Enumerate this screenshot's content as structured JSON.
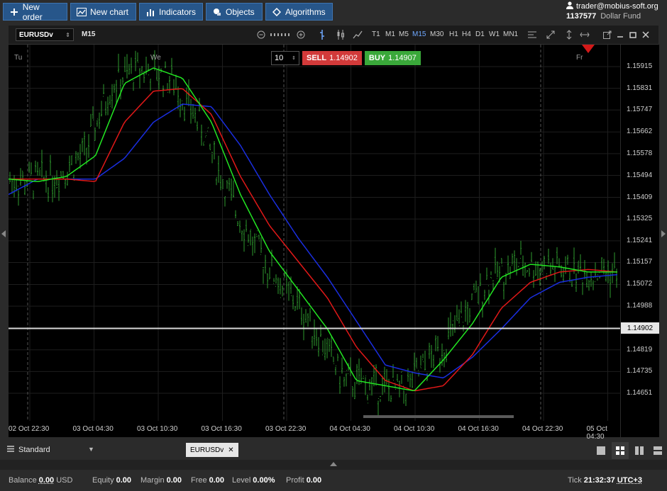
{
  "toolbar": {
    "buttons": [
      {
        "label": "New order",
        "icon": "plus-icon"
      },
      {
        "label": "New chart",
        "icon": "chart-icon"
      },
      {
        "label": "Indicators",
        "icon": "bar-chart-icon"
      },
      {
        "label": "Objects",
        "icon": "objects-icon"
      },
      {
        "label": "Algorithms",
        "icon": "diamond-icon"
      }
    ]
  },
  "account": {
    "user": "trader@mobius-soft.org",
    "number": "1137577",
    "fund": "Dollar Fund"
  },
  "chart": {
    "symbol": "EURUSDv",
    "timeframe": "M15",
    "timeframes": [
      "T1",
      "M1",
      "M5",
      "M15",
      "M30",
      "H1",
      "H4",
      "D1",
      "W1",
      "MN1"
    ],
    "active_timeframe": "M15",
    "days": [
      "Tu",
      "We",
      "Fr"
    ],
    "trade": {
      "lots": "10",
      "sell_label": "SELL",
      "sell_price": "1.14902",
      "buy_label": "BUY",
      "buy_price": "1.14907"
    },
    "price_labels": [
      "1.15915",
      "1.15831",
      "1.15747",
      "1.15662",
      "1.15578",
      "1.15494",
      "1.15409",
      "1.15325",
      "1.15241",
      "1.15157",
      "1.15072",
      "1.14988",
      "1.14902",
      "1.14819",
      "1.14735",
      "1.14651"
    ],
    "current_price": "1.14902",
    "time_labels": [
      "02 Oct 22:30",
      "03 Oct 04:30",
      "03 Oct 10:30",
      "03 Oct 16:30",
      "03 Oct 22:30",
      "04 Oct 04:30",
      "04 Oct 10:30",
      "04 Oct 16:30",
      "04 Oct 22:30",
      "05 Oct 04:30"
    ],
    "colors": {
      "bars": "#2e9a2e",
      "ma_fast": "#22e622",
      "ma_mid": "#e01818",
      "ma_slow": "#1a2ee0",
      "price_line": "#d9d9d9"
    }
  },
  "chart_data": {
    "type": "line",
    "series": [
      {
        "values": [
          1.1548,
          1.1547,
          1.1549,
          1.1557,
          1.1585,
          1.1591,
          1.1587,
          1.157,
          1.1542,
          1.152,
          1.1505,
          1.149,
          1.147,
          1.1468,
          1.1466,
          1.1478,
          1.1492,
          1.151,
          1.1515,
          1.1514,
          1.1512,
          1.1512
        ]
      },
      {
        "values": [
          1.1548,
          1.1548,
          1.1548,
          1.1547,
          1.157,
          1.1582,
          1.1583,
          1.1573,
          1.1549,
          1.153,
          1.1516,
          1.1502,
          1.1483,
          1.147,
          1.1466,
          1.1468,
          1.148,
          1.1498,
          1.1508,
          1.1512,
          1.1513,
          1.1512
        ]
      },
      {
        "values": [
          1.1542,
          1.1548,
          1.1548,
          1.1548,
          1.1556,
          1.157,
          1.1577,
          1.1576,
          1.1561,
          1.1542,
          1.1525,
          1.151,
          1.1493,
          1.1476,
          1.1473,
          1.1471,
          1.1479,
          1.149,
          1.1502,
          1.1508,
          1.151,
          1.1511
        ]
      }
    ]
  },
  "workspace": {
    "label": "Standard",
    "tab": "EURUSDv"
  },
  "status": {
    "balance_label": "Balance",
    "balance": "0.00",
    "currency": "USD",
    "equity_label": "Equity",
    "equity": "0.00",
    "margin_label": "Margin",
    "margin": "0.00",
    "free_label": "Free",
    "free": "0.00",
    "level_label": "Level",
    "level": "0.00%",
    "profit_label": "Profit",
    "profit": "0.00",
    "tick_label": "Tick",
    "time": "21:32:37",
    "tz": "UTC+3"
  }
}
